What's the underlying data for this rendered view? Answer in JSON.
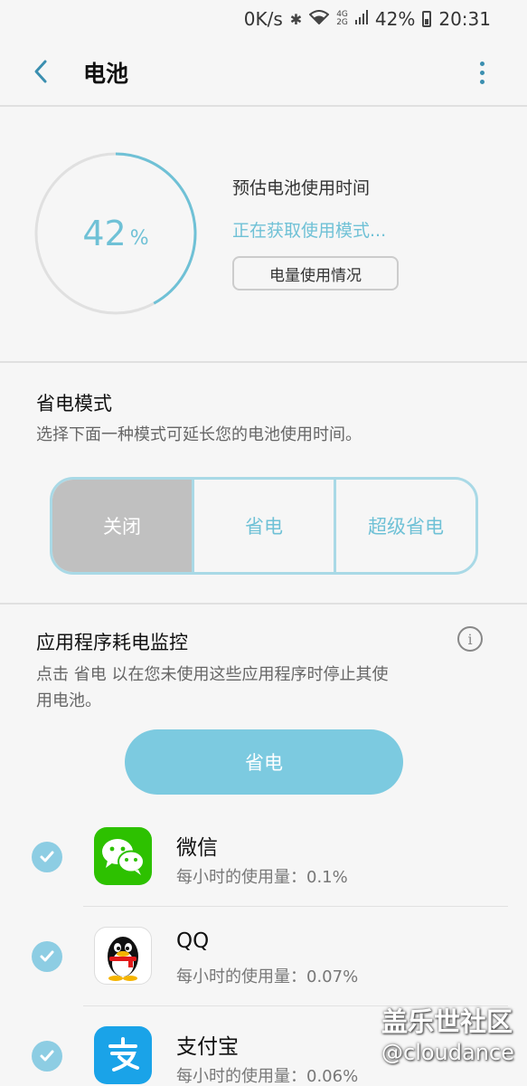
{
  "status_bar": {
    "net_speed": "0K/s",
    "net_4g": "4G",
    "net_2g": "2G",
    "battery_pct": "42%",
    "time": "20:31"
  },
  "header": {
    "title": "电池"
  },
  "battery": {
    "level_num": "42",
    "level_sign": "%",
    "level_fraction": 0.42,
    "estimate_label": "预估电池使用时间",
    "estimate_status": "正在获取使用模式...",
    "usage_button": "电量使用情况"
  },
  "power_mode": {
    "title": "省电模式",
    "description": "选择下面一种模式可延长您的电池使用时间。",
    "options": [
      "关闭",
      "省电",
      "超级省电"
    ],
    "selected": "关闭"
  },
  "app_monitor": {
    "title": "应用程序耗电监控",
    "description": "点击 省电 以在您未使用这些应用程序时停止其使用电池。",
    "save_button": "省电",
    "apps": [
      {
        "name": "微信",
        "usage": "每小时的使用量：0.1%",
        "checked": true,
        "icon": "wechat-icon"
      },
      {
        "name": "QQ",
        "usage": "每小时的使用量：0.07%",
        "checked": true,
        "icon": "qq-icon"
      },
      {
        "name": "支付宝",
        "usage": "每小时的使用量：0.06%",
        "checked": true,
        "icon": "alipay-icon"
      }
    ]
  },
  "watermark": {
    "line1": "盖乐世社区",
    "line2": "@cloudance"
  },
  "colors": {
    "accent": "#6fc1d6",
    "button": "#7ccae0",
    "selected_mode": "#c0c0c0"
  }
}
